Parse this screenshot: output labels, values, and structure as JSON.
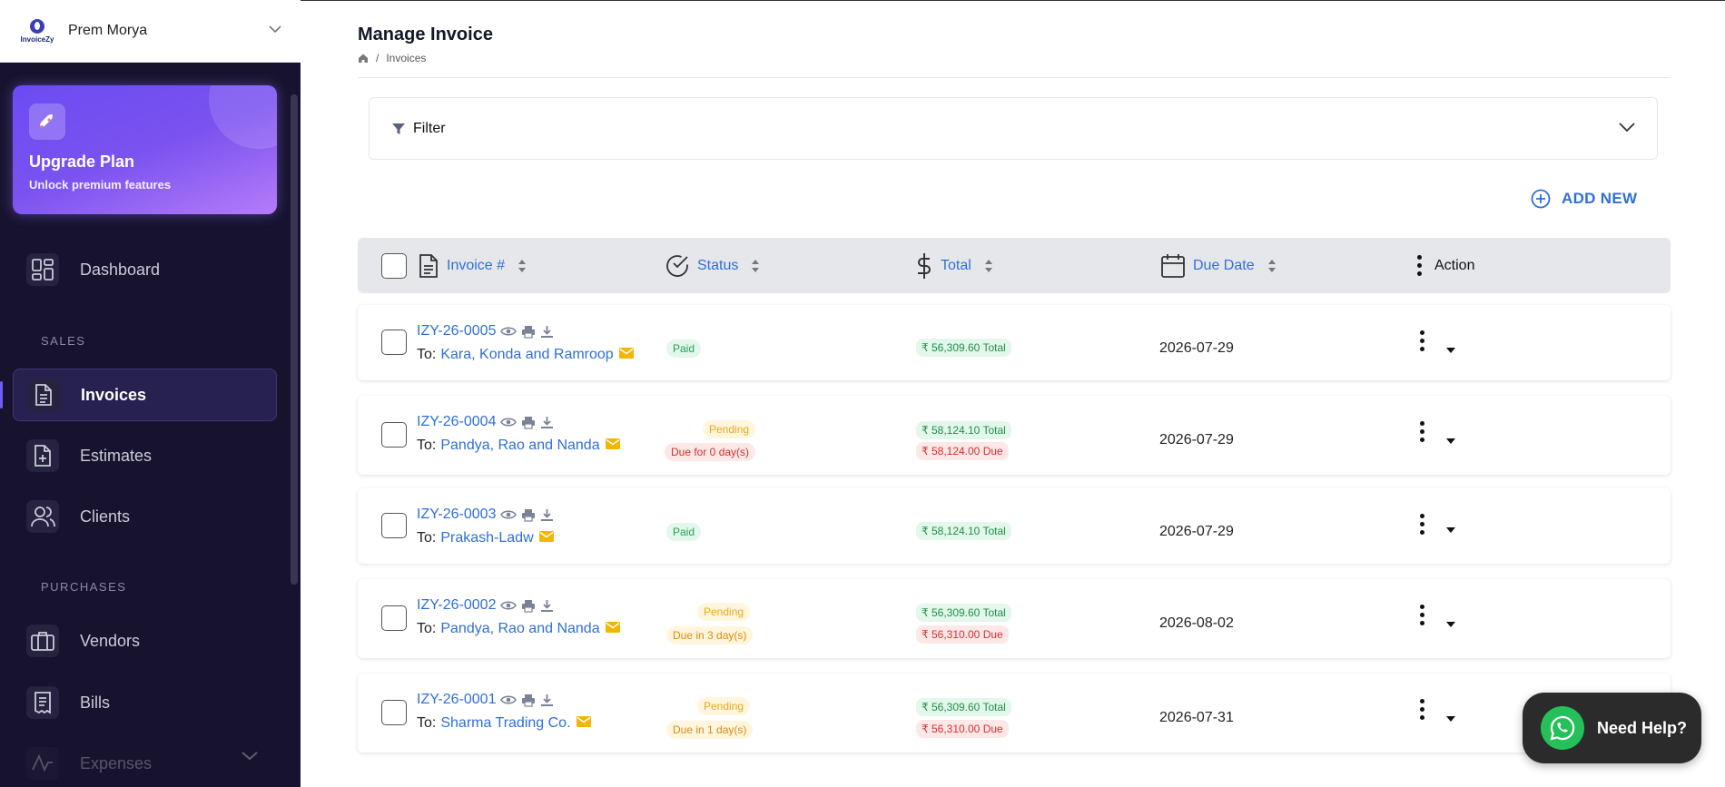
{
  "app": {
    "logo_text": "InvoiceZy",
    "user_name": "Prem Morya"
  },
  "upgrade": {
    "title": "Upgrade Plan",
    "subtitle": "Unlock premium features"
  },
  "sidebar": {
    "items": [
      {
        "label": "Dashboard"
      },
      {
        "label": "Invoices"
      },
      {
        "label": "Estimates"
      },
      {
        "label": "Clients"
      },
      {
        "label": "Vendors"
      },
      {
        "label": "Bills"
      },
      {
        "label": "Expenses"
      }
    ],
    "sections": {
      "sales": "SALES",
      "purchases": "PURCHASES"
    }
  },
  "page": {
    "title": "Manage Invoice",
    "breadcrumb_current": "Invoices",
    "breadcrumb_sep": "/"
  },
  "filter": {
    "label": "Filter"
  },
  "actions": {
    "add_new": "ADD NEW"
  },
  "table": {
    "headers": {
      "invoice": "Invoice #",
      "status": "Status",
      "total": "Total",
      "due_date": "Due Date",
      "action": "Action"
    },
    "to_prefix": "To:",
    "rows": [
      {
        "number": "IZY-26-0005",
        "client": "Kara, Konda and Ramroop",
        "status": "Paid",
        "status_note": "",
        "total": "₹ 56,309.60 Total",
        "due": "",
        "due_date": "2026-07-29"
      },
      {
        "number": "IZY-26-0004",
        "client": "Pandya, Rao and Nanda",
        "status": "Pending",
        "status_note": "Due for 0 day(s)",
        "total": "₹ 58,124.10 Total",
        "due": "₹ 58,124.00 Due",
        "due_date": "2026-07-29"
      },
      {
        "number": "IZY-26-0003",
        "client": "Prakash-Ladw",
        "status": "Paid",
        "status_note": "",
        "total": "₹ 58,124.10 Total",
        "due": "",
        "due_date": "2026-07-29"
      },
      {
        "number": "IZY-26-0002",
        "client": "Pandya, Rao and Nanda",
        "status": "Pending",
        "status_note": "Due in 3 day(s)",
        "total": "₹ 56,309.60 Total",
        "due": "₹ 56,310.00 Due",
        "due_date": "2026-08-02"
      },
      {
        "number": "IZY-26-0001",
        "client": "Sharma Trading Co.",
        "status": "Pending",
        "status_note": "Due in 1 day(s)",
        "total": "₹ 56,309.60 Total",
        "due": "₹ 56,310.00 Due",
        "due_date": "2026-07-31"
      }
    ]
  },
  "help": {
    "label": "Need Help?"
  },
  "colors": {
    "sidebar_bg": "#17132e",
    "accent_blue": "#2f6fd8",
    "paid_green": "#22a355",
    "pending_amber": "#e5a823",
    "due_red": "#d32f2f",
    "whatsapp": "#25c05a"
  }
}
